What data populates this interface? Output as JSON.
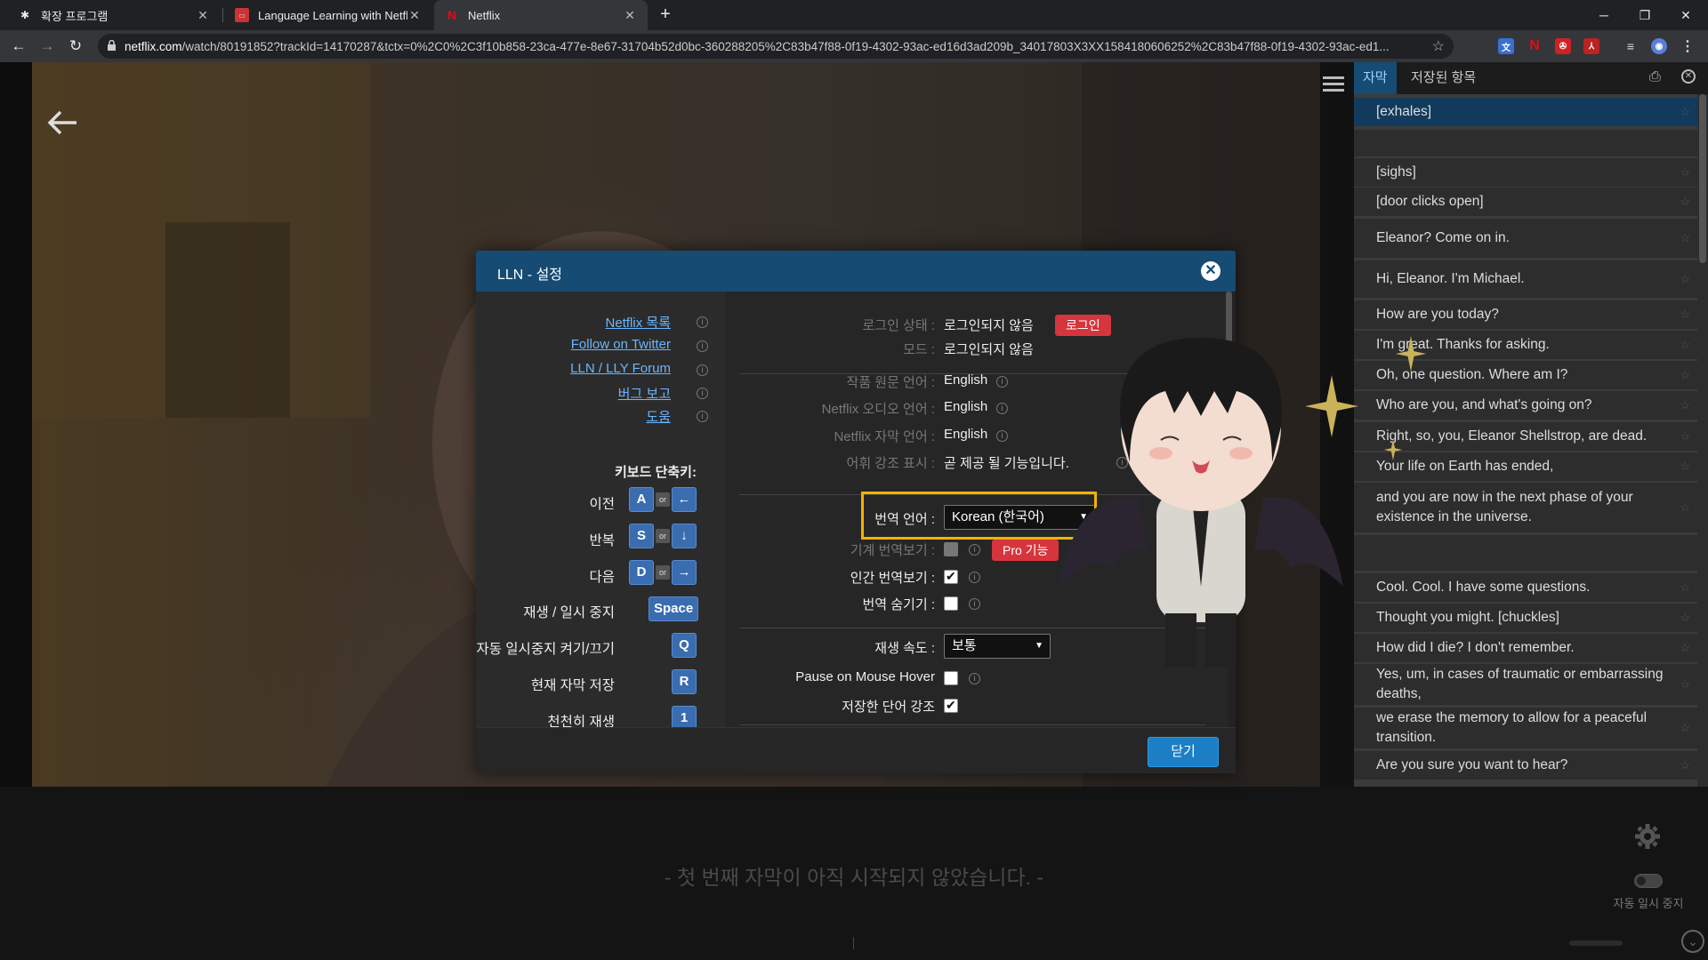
{
  "browser": {
    "tabs": [
      {
        "title": "확장 프로그램",
        "icon": "puzzle-icon"
      },
      {
        "title": "Language Learning with Netflix",
        "icon": "lln-icon"
      },
      {
        "title": "Netflix",
        "icon": "netflix-icon"
      }
    ],
    "url_host": "netflix.com",
    "url_rest": "/watch/80191852?trackId=14170287&tctx=0%2C0%2C3f10b858-23ca-477e-8e67-31704b52d0bc-360288205%2C83b47f88-0f19-4302-93ac-ed16d3ad209b_34017803X3XX1584180606252%2C83b47f88-0f19-4302-93ac-ed1..."
  },
  "side_panel": {
    "tab_subtitles": "자막",
    "tab_saved": "저장된 항목",
    "subtitles": [
      "[exhales]",
      "",
      "[sighs]",
      "[door clicks open]",
      "Eleanor? Come on in.",
      "Hi, Eleanor. I'm Michael.",
      "How are you today?",
      "I'm great. Thanks for asking.",
      "Oh, one question. Where am I?",
      "Who are you, and what's going on?",
      "Right, so, you, Eleanor Shellstrop, are dead.",
      "Your life on Earth has ended,",
      "and you are now in the next phase of your existence in the universe.",
      "",
      "Cool. Cool. I have some questions.",
      "Thought you might. [chuckles]",
      "How did I die? I don't remember.",
      "Yes, um, in cases of traumatic or embarrassing deaths,",
      "we erase the memory to allow for a peaceful transition.",
      "Are you sure you want to hear?"
    ]
  },
  "player": {
    "subtitle_placeholder": "- 첫 번째 자막이 아직 시작되지 않았습니다. -",
    "auto_pause_label": "자동 일시 중지"
  },
  "modal": {
    "title": "LLN - 설정",
    "links": [
      "Netflix 목록",
      "Follow on Twitter",
      "LLN / LLY Forum",
      "버그 보고",
      "도움"
    ],
    "shortcuts_title": "키보드 단축키:",
    "shortcuts": [
      {
        "label": "이전",
        "key1": "A",
        "or": "or",
        "key2": "←"
      },
      {
        "label": "반복",
        "key1": "S",
        "or": "or",
        "key2": "↓"
      },
      {
        "label": "다음",
        "key1": "D",
        "or": "or",
        "key2": "→"
      },
      {
        "label": "재생 / 일시 중지",
        "key1": "Space"
      },
      {
        "label": "자동 일시중지 켜기/끄기",
        "key1": "Q"
      },
      {
        "label": "현재 자막 저장",
        "key1": "R"
      },
      {
        "label": "천천히 재생",
        "key1": "1"
      }
    ],
    "settings": {
      "login_status_label": "로그인 상태 :",
      "login_status_value": "로그인되지 않음",
      "login_button": "로그인",
      "mode_label": "모드 :",
      "mode_value": "로그인되지 않음",
      "source_lang_label": "작품 원문 언어 :",
      "source_lang_value": "English",
      "audio_lang_label": "Netflix 오디오 언어 :",
      "audio_lang_value": "English",
      "sub_lang_label": "Netflix 자막 언어 :",
      "sub_lang_value": "English",
      "vocab_label": "어휘 강조 표시 :",
      "vocab_value": "곧 제공 될 기능입니다.",
      "translation_lang_label": "번역 언어 :",
      "translation_lang_value": "Korean (한국어)",
      "machine_translation_label": "기계 번역보기 :",
      "pro_badge": "Pro 기능",
      "human_translation_label": "인간 번역보기 :",
      "human_translation_checked": true,
      "hide_translation_label": "번역 숨기기 :",
      "hide_translation_checked": false,
      "speed_label": "재생 속도 :",
      "speed_value": "보통",
      "pause_hover_label": "Pause on Mouse Hover",
      "pause_hover_checked": false,
      "highlight_saved_label": "저장한 단어 강조",
      "highlight_saved_checked": true
    },
    "close_button": "닫기"
  },
  "colors": {
    "accent": "#164b73",
    "button_blue": "#1c7ec5",
    "red": "#d6353d",
    "highlight": "#f0b400"
  }
}
